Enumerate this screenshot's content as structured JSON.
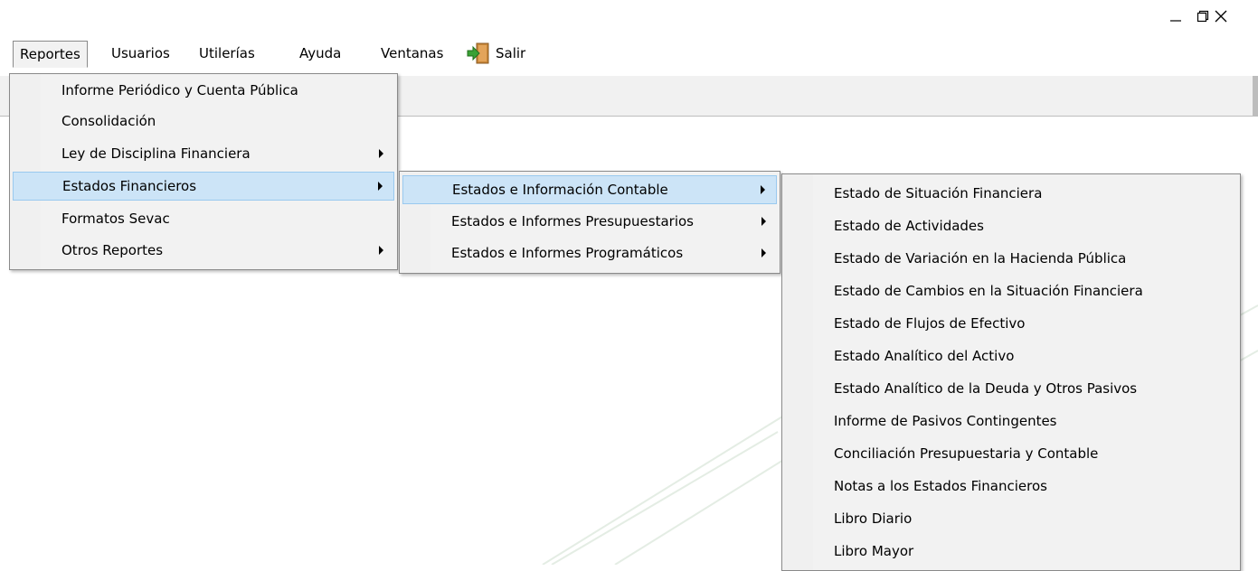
{
  "window": {
    "controls": {
      "minimize": "minimize-icon",
      "restore": "restore-icon",
      "close": "close-icon"
    }
  },
  "menubar": {
    "items": [
      {
        "label": "Reportes"
      },
      {
        "label": "Usuarios"
      },
      {
        "label": "Utilerías"
      },
      {
        "label": "Ayuda"
      },
      {
        "label": "Ventanas"
      },
      {
        "label": "Salir",
        "icon": "exit-door-icon"
      }
    ]
  },
  "reportes_menu": {
    "items": [
      {
        "label": "Informe Periódico y Cuenta Pública",
        "submenu": false
      },
      {
        "label": "Consolidación",
        "submenu": false
      },
      {
        "label": "Ley de Disciplina Financiera",
        "submenu": true
      },
      {
        "label": "Estados Financieros",
        "submenu": true,
        "highlighted": true
      },
      {
        "label": "Formatos Sevac",
        "submenu": false
      },
      {
        "label": "Otros Reportes",
        "submenu": true
      }
    ]
  },
  "estados_financieros_menu": {
    "items": [
      {
        "label": "Estados e Información Contable",
        "submenu": true,
        "highlighted": true
      },
      {
        "label": "Estados e Informes Presupuestarios",
        "submenu": true
      },
      {
        "label": "Estados e Informes Programáticos",
        "submenu": true
      }
    ]
  },
  "contable_menu": {
    "items": [
      {
        "label": "Estado de Situación Financiera"
      },
      {
        "label": "Estado de Actividades"
      },
      {
        "label": "Estado de Variación en la Hacienda Pública"
      },
      {
        "label": "Estado de Cambios en la Situación Financiera"
      },
      {
        "label": "Estado de Flujos de Efectivo"
      },
      {
        "label": "Estado Analítico del Activo"
      },
      {
        "label": "Estado Analítico de la Deuda y Otros Pasivos"
      },
      {
        "label": "Informe de Pasivos Contingentes"
      },
      {
        "label": "Conciliación Presupuestaria y Contable"
      },
      {
        "label": "Notas a los Estados Financieros"
      },
      {
        "label": "Libro Diario"
      },
      {
        "label": "Libro Mayor"
      }
    ]
  },
  "colors": {
    "highlight_bg": "#cce4f7",
    "highlight_border": "#99c9ef",
    "menu_bg": "#f2f2f2",
    "deco_stripe": "#e4ede4"
  }
}
